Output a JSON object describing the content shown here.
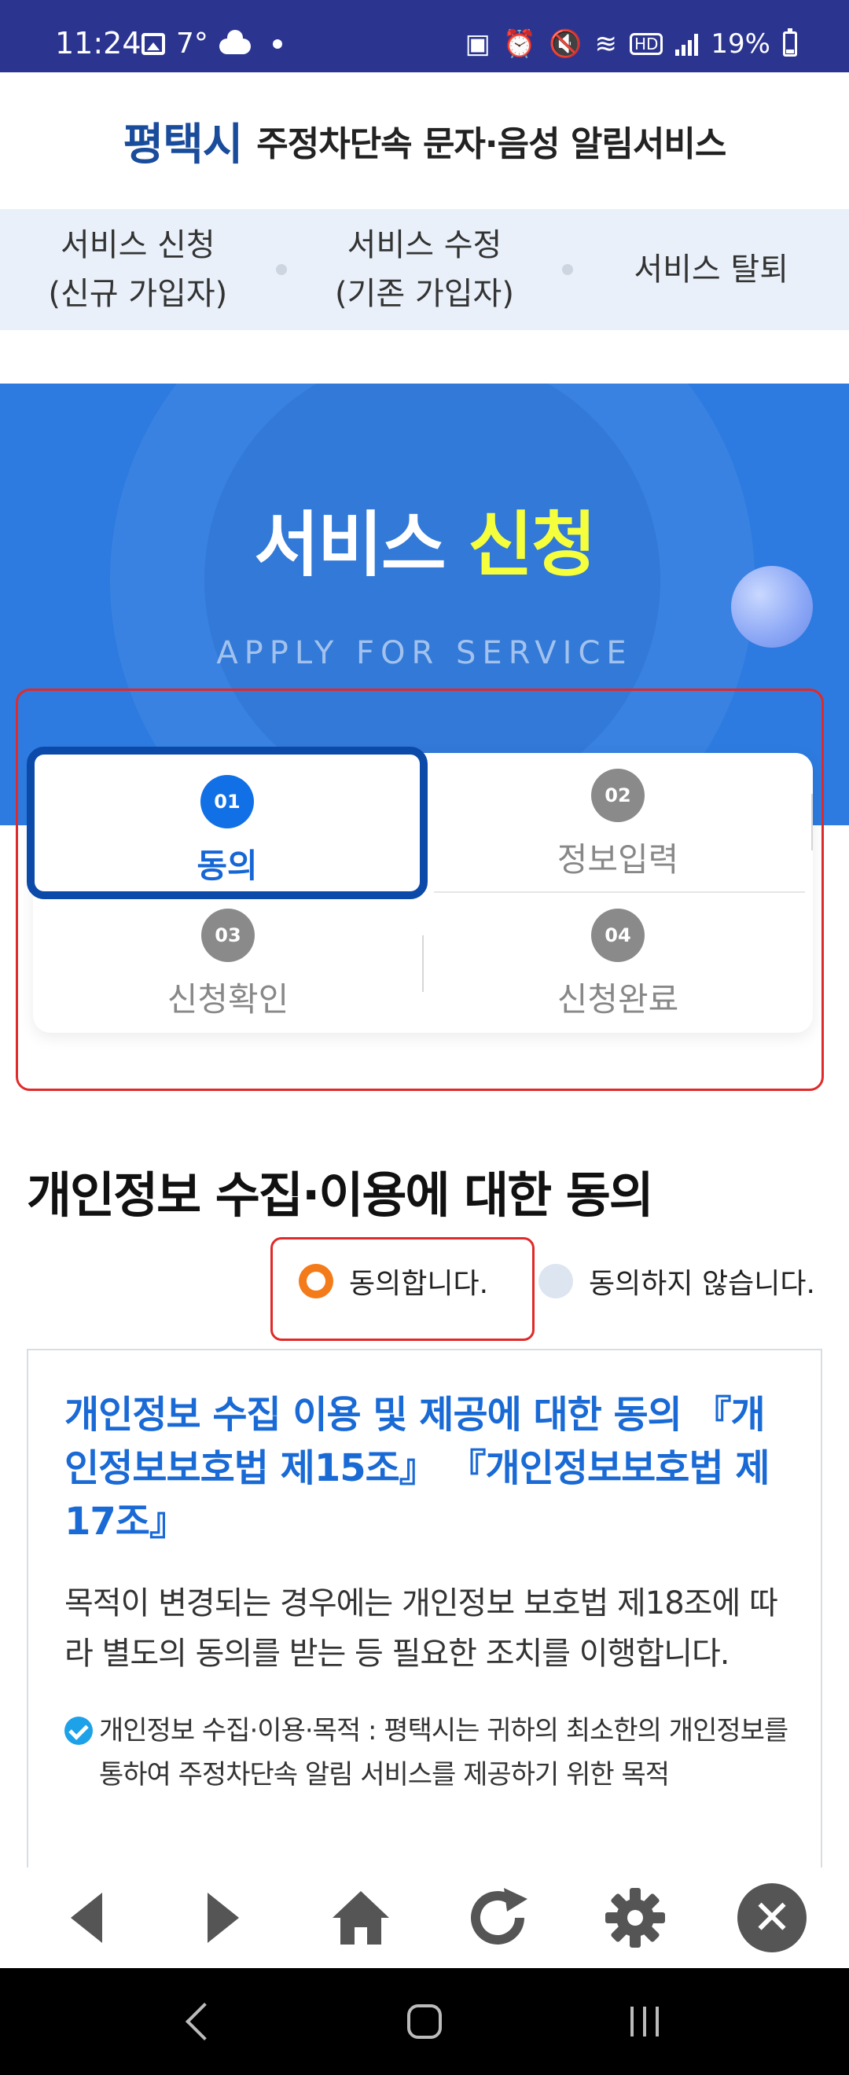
{
  "status_bar": {
    "time": "11:24",
    "temperature": "7°",
    "battery": "19%",
    "icons": [
      "image-icon",
      "cloud-icon",
      "dot-icon",
      "battery-saver-icon",
      "alarm-icon",
      "mute-icon",
      "wifi-icon",
      "hd-icon",
      "signal-icon",
      "battery-icon"
    ]
  },
  "header": {
    "city": "평택시",
    "service_name": "주정차단속 문자·음성 알림서비스"
  },
  "nav": {
    "items": [
      {
        "line1": "서비스 신청",
        "line2": "(신규 가입자)"
      },
      {
        "line1": "서비스 수정",
        "line2": "(기존 가입자)"
      },
      {
        "line1": "서비스 탈퇴",
        "line2": ""
      }
    ]
  },
  "hero": {
    "title_white": "서비스",
    "title_yellow": "신청",
    "subtitle": "APPLY FOR SERVICE"
  },
  "steps": [
    {
      "num": "01",
      "label": "동의",
      "active": true
    },
    {
      "num": "02",
      "label": "정보입력",
      "active": false
    },
    {
      "num": "03",
      "label": "신청확인",
      "active": false
    },
    {
      "num": "04",
      "label": "신청완료",
      "active": false
    }
  ],
  "consent": {
    "section_title": "개인정보 수집·이용에 대한 동의",
    "agree_label": "동의합니다.",
    "disagree_label": "동의하지 않습니다.",
    "selected": "agree",
    "box_heading": "개인정보 수집 이용 및 제공에 대한 동의 『개인정보보호법 제15조』 『개인정보보호법 제17조』",
    "box_body": "목적이 변경되는 경우에는 개인정보 보호법 제18조에 따라 별도의 동의를 받는 등 필요한 조치를 이행합니다.",
    "bullet_1": "개인정보 수집·이용·목적 : 평택시는 귀하의 최소한의 개인정보를 통하여 주정차단속 알림 서비스를 제공하기 위한 목적"
  },
  "toolbar": {
    "icons": [
      "back-icon",
      "forward-icon",
      "home-icon",
      "refresh-icon",
      "settings-icon",
      "close-icon"
    ]
  },
  "colors": {
    "status_bar": "#2b3590",
    "brand_blue": "#1a4c9c",
    "hero_blue": "#2d7be0",
    "highlight_yellow": "#f6ff3b",
    "active_step": "#0b4aa8",
    "radio_orange": "#f47b1a",
    "annotation_red": "#e02a2a"
  }
}
